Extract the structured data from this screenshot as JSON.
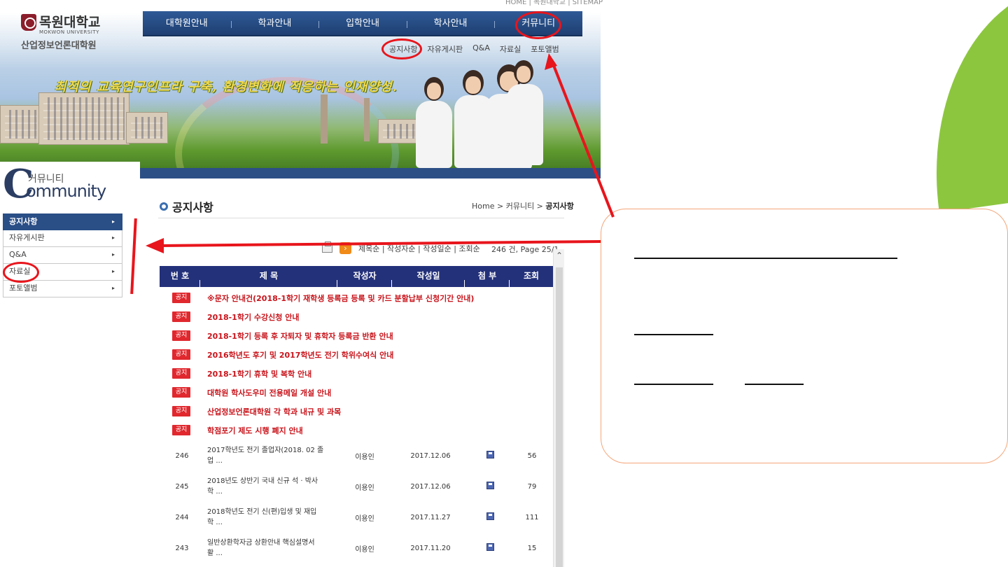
{
  "top_util": "HOME | 목원대학교 | SITEMAP",
  "logo": {
    "name": "목원대학교",
    "eng": "MOKWON UNIVERSITY",
    "sub": "산업정보언론대학원"
  },
  "slogan": "최적의 교육연구인프라 구축, 환경변화에 적응하는 인재양성.",
  "gnb": [
    "대학원안내",
    "학과안내",
    "입학안내",
    "학사안내",
    "커뮤니티"
  ],
  "lnb": [
    "공지사항",
    "자유게시판",
    "Q&A",
    "자료실",
    "포토앨범"
  ],
  "side": {
    "ko": "커뮤니티",
    "letter": "C",
    "en": "ommunity",
    "items": [
      "공지사항",
      "자유게시판",
      "Q&A",
      "자료실",
      "포토앨범"
    ],
    "arrow": "▸"
  },
  "page": {
    "title": "공지사항",
    "crumb_home": "Home",
    "crumb_sep1": " > ",
    "crumb_mid": "커뮤니티",
    "crumb_sep2": " > ",
    "crumb_cur": "공지사항",
    "sort": "제목순 | 작성자순 | 작성일순 | 조회순",
    "rss": "›",
    "info": "246 건,  Page 25/1"
  },
  "table": {
    "headers": [
      "번 호",
      "제 목",
      "작성자",
      "작성일",
      "첨 부",
      "조회"
    ]
  },
  "notice_badge": "공지",
  "notices": [
    "※문자 안내건(2018-1학기 재학생 등록금 등록 및 카드 분할납부 신청기간 안내)",
    "2018-1학기 수강신청 안내",
    "2018-1학기 등록 후 자퇴자 및 휴학자 등록금 반환 안내",
    "2016학년도 후기 및 2017학년도 전기 학위수여식 안내",
    "2018-1학기 휴학 및 복학 안내",
    "대학원 학사도우미 전용메일 개설 안내",
    "산업정보언론대학원 각 학과 내규 및 과목",
    "학점포기 제도 시행 폐지 안내"
  ],
  "posts": [
    {
      "no": "246",
      "title1": "2017학년도 전기 졸업자(2018. 02 졸",
      "title2": "업 ...",
      "author": "이용인",
      "date": "2017.12.06",
      "hits": "56"
    },
    {
      "no": "245",
      "title1": "2018년도 상반기 국내 신규 석 · 박사",
      "title2": "학 ...",
      "author": "이용인",
      "date": "2017.12.06",
      "hits": "79"
    },
    {
      "no": "244",
      "title1": "2018학년도 전기 신(편)입생 및 재입",
      "title2": "학 ...",
      "author": "이용인",
      "date": "2017.11.27",
      "hits": "111"
    },
    {
      "no": "243",
      "title1": "일반상환학자금 상환안내 핵심설명서",
      "title2": "활 ...",
      "author": "이용인",
      "date": "2017.11.20",
      "hits": "15"
    }
  ],
  "colors": {
    "nav": "#23307a",
    "accent_red": "#e8151c",
    "notice_red": "#c8141b",
    "leaf": "#8cc63f",
    "callout_border": "#f4a67a"
  }
}
